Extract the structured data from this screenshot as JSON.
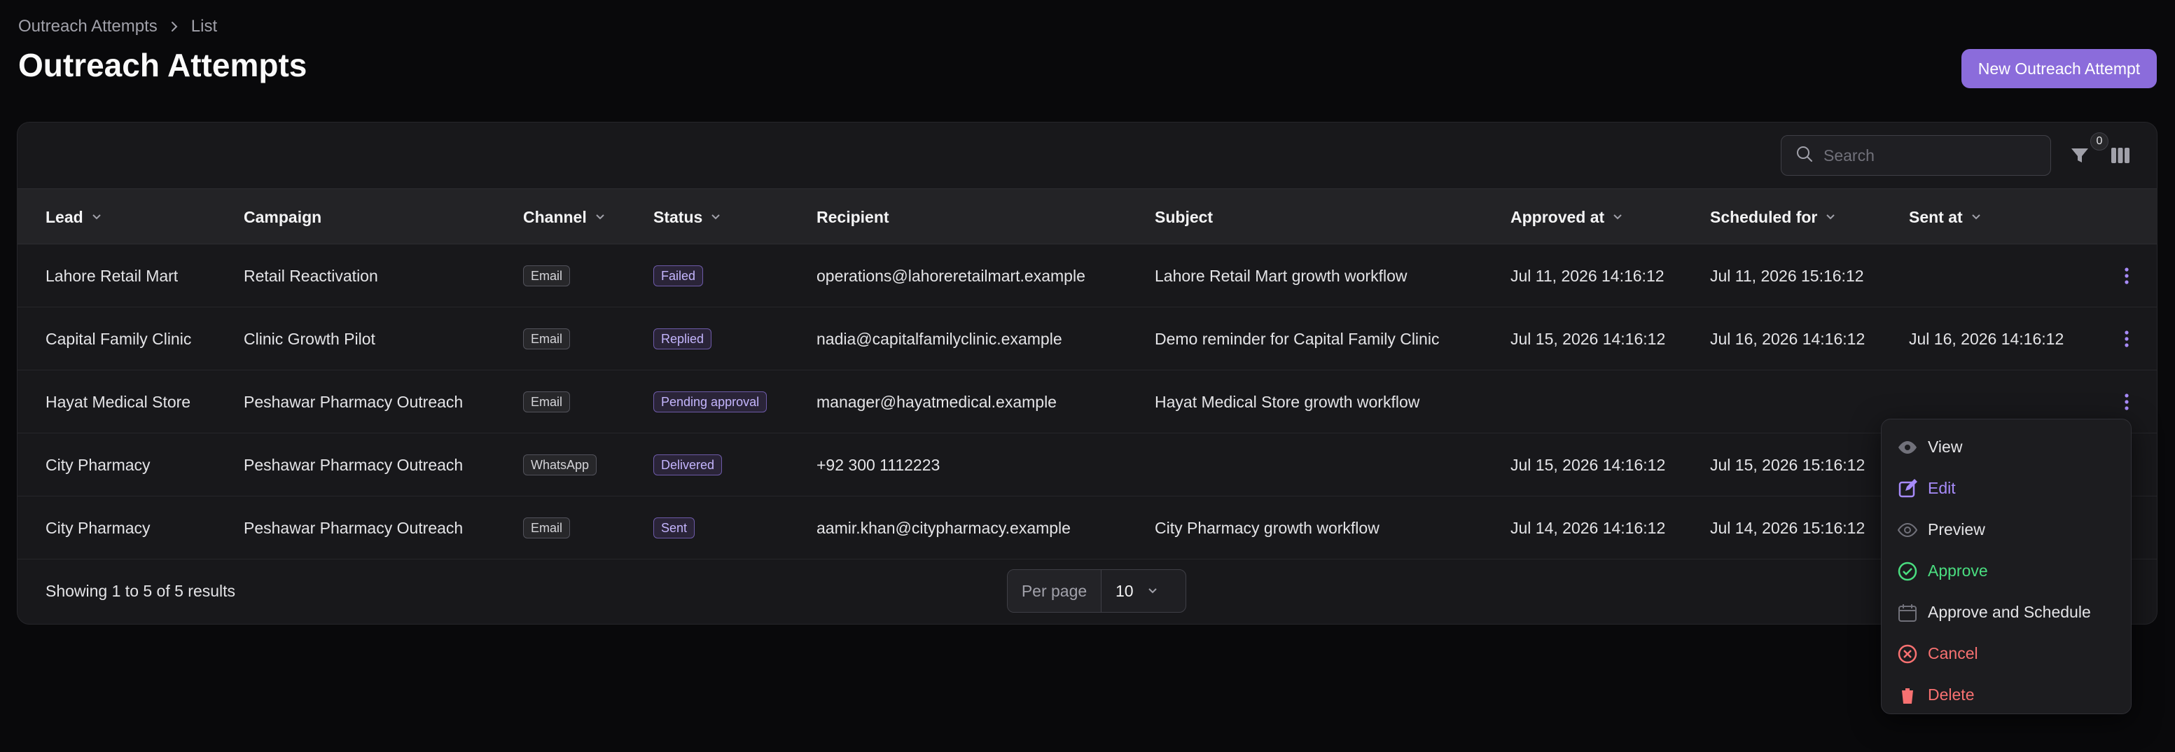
{
  "breadcrumb": {
    "parent": "Outreach Attempts",
    "current": "List"
  },
  "page_title": "Outreach Attempts",
  "new_button": "New Outreach Attempt",
  "toolbar": {
    "search_placeholder": "Search",
    "filter_count": "0"
  },
  "columns": {
    "lead": "Lead",
    "campaign": "Campaign",
    "channel": "Channel",
    "status": "Status",
    "recipient": "Recipient",
    "subject": "Subject",
    "approved_at": "Approved at",
    "scheduled_for": "Scheduled for",
    "sent_at": "Sent at"
  },
  "rows": [
    {
      "lead": "Lahore Retail Mart",
      "campaign": "Retail Reactivation",
      "channel": "Email",
      "status": "Failed",
      "recipient": "operations@lahoreretailmart.example",
      "subject": "Lahore Retail Mart growth workflow",
      "approved_at": "Jul 11, 2026 14:16:12",
      "scheduled_for": "Jul 11, 2026 15:16:12",
      "sent_at": ""
    },
    {
      "lead": "Capital Family Clinic",
      "campaign": "Clinic Growth Pilot",
      "channel": "Email",
      "status": "Replied",
      "recipient": "nadia@capitalfamilyclinic.example",
      "subject": "Demo reminder for Capital Family Clinic",
      "approved_at": "Jul 15, 2026 14:16:12",
      "scheduled_for": "Jul 16, 2026 14:16:12",
      "sent_at": "Jul 16, 2026 14:16:12"
    },
    {
      "lead": "Hayat Medical Store",
      "campaign": "Peshawar Pharmacy Outreach",
      "channel": "Email",
      "status": "Pending approval",
      "recipient": "manager@hayatmedical.example",
      "subject": "Hayat Medical Store growth workflow",
      "approved_at": "",
      "scheduled_for": "",
      "sent_at": ""
    },
    {
      "lead": "City Pharmacy",
      "campaign": "Peshawar Pharmacy Outreach",
      "channel": "WhatsApp",
      "status": "Delivered",
      "recipient": "+92 300 1112223",
      "subject": "",
      "approved_at": "Jul 15, 2026 14:16:12",
      "scheduled_for": "Jul 15, 2026 15:16:12",
      "sent_at": ""
    },
    {
      "lead": "City Pharmacy",
      "campaign": "Peshawar Pharmacy Outreach",
      "channel": "Email",
      "status": "Sent",
      "recipient": "aamir.khan@citypharmacy.example",
      "subject": "City Pharmacy growth workflow",
      "approved_at": "Jul 14, 2026 14:16:12",
      "scheduled_for": "Jul 14, 2026 15:16:12",
      "sent_at": ""
    }
  ],
  "footer": {
    "showing": "Showing 1 to 5 of 5 results",
    "per_page_label": "Per page",
    "per_page_value": "10"
  },
  "action_menu": {
    "items": [
      {
        "label": "View",
        "icon": "eye-icon",
        "color": "#e4e4e7"
      },
      {
        "label": "Edit",
        "icon": "pencil-square-icon",
        "color": "#a78bfa"
      },
      {
        "label": "Preview",
        "icon": "eye-outline-icon",
        "color": "#e4e4e7"
      },
      {
        "label": "Approve",
        "icon": "check-circle-icon",
        "color": "#4ade80"
      },
      {
        "label": "Approve and Schedule",
        "icon": "calendar-icon",
        "color": "#e4e4e7"
      },
      {
        "label": "Cancel",
        "icon": "x-circle-icon",
        "color": "#f87171"
      },
      {
        "label": "Delete",
        "icon": "trash-icon",
        "color": "#f87171"
      }
    ]
  },
  "colors": {
    "accent": "#8b6cdb",
    "background": "#09090b",
    "panel": "#18181b"
  }
}
